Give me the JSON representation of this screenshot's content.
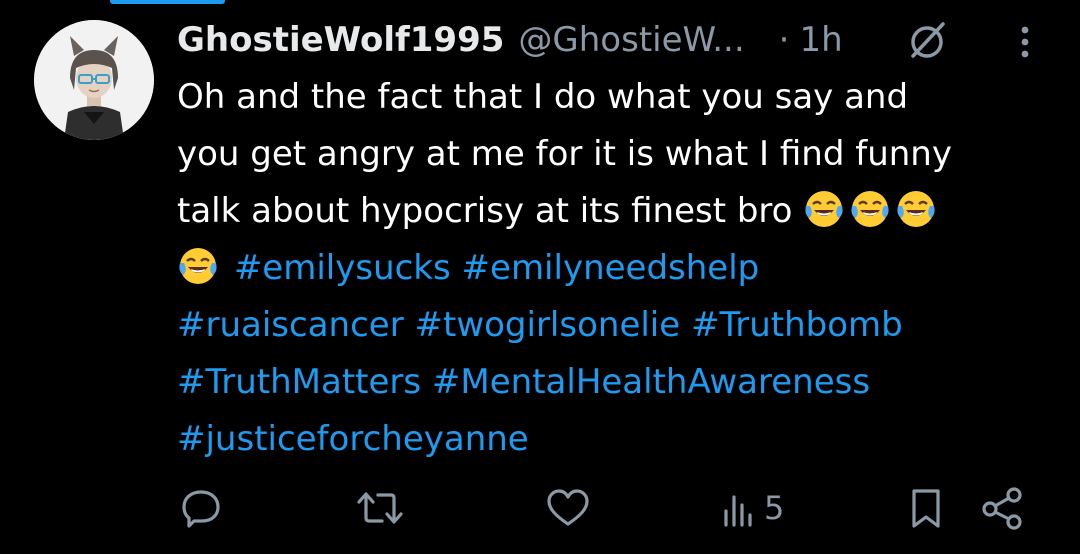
{
  "post": {
    "display_name": "GhostieWolf1995",
    "handle": "@GhostieW...",
    "separator": "·",
    "time": "1h",
    "lines": {
      "l1": "Oh and the fact that I do what you say and",
      "l2": "you get angry at me for it is what I find funny",
      "l3": "talk about hypocrisy at its finest bro"
    },
    "emoji_name": "face-with-tears-of-joy",
    "hashtags": {
      "h1": "#emilysucks",
      "h2": "#emilyneedshelp",
      "h3": "#ruaiscancer",
      "h4": "#twogirlsonelie",
      "h5": "#Truthbomb",
      "h6": "#TruthMatters",
      "h7": "#MentalHealthAwareness",
      "h8": "#justiceforcheyanne"
    }
  },
  "actions": {
    "views_count": "5"
  },
  "icons": {
    "header": [
      "grok-icon",
      "more-icon"
    ],
    "actions": [
      "reply-icon",
      "repost-icon",
      "like-icon",
      "views-icon",
      "bookmark-icon",
      "share-icon"
    ]
  },
  "colors": {
    "background": "#000000",
    "text": "#ffffff",
    "muted": "#8b98a5",
    "accent": "#1d9bf0"
  }
}
